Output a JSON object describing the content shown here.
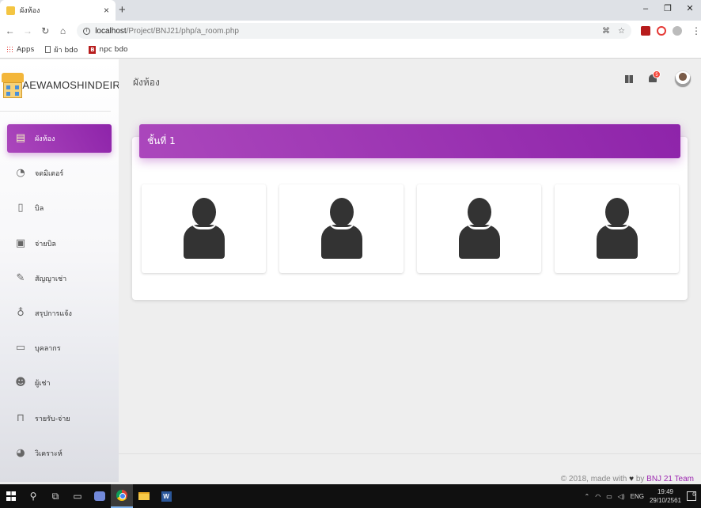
{
  "browser": {
    "tab_title": "ผังห้อง",
    "url_host": "localhost",
    "url_path": "/Project/BNJ21/php/a_room.php",
    "bookmarks": [
      "Apps",
      "ผ้า bdo",
      "npc bdo"
    ]
  },
  "sidebar": {
    "brand": "OMAEWAMOSHINDEIRU",
    "items": [
      {
        "label": "ผังห้อง",
        "icon": "building-icon",
        "active": true
      },
      {
        "label": "จดมิเตอร์",
        "icon": "dashboard-gauge-icon",
        "active": false
      },
      {
        "label": "บิล",
        "icon": "document-icon",
        "active": false
      },
      {
        "label": "จ่ายบิล",
        "icon": "money-icon",
        "active": false
      },
      {
        "label": "สัญญาเช่า",
        "icon": "edit-icon",
        "active": false
      },
      {
        "label": "สรุปการแจ้ง",
        "icon": "lightbulb-icon",
        "active": false
      },
      {
        "label": "บุคลากร",
        "icon": "id-card-icon",
        "active": false
      },
      {
        "label": "ผู้เช่า",
        "icon": "users-icon",
        "active": false
      },
      {
        "label": "รายรับ-จ่าย",
        "icon": "shopping-bag-icon",
        "active": false
      },
      {
        "label": "วิเคราะห์",
        "icon": "pie-chart-icon",
        "active": false
      }
    ]
  },
  "topnav": {
    "title": "ผังห้อง",
    "notification_count": "5"
  },
  "content": {
    "floor_title": "ชั้นที่ 1",
    "rooms": [
      "room-1",
      "room-2",
      "room-3",
      "room-4"
    ]
  },
  "footer": {
    "prefix": "© 2018, made with",
    "by": "by",
    "team": "BNJ 21 Team"
  },
  "taskbar": {
    "language": "ENG",
    "time": "19:49",
    "date": "29/10/2561",
    "notification_count": "6"
  },
  "colors": {
    "accent": "#9c27b0",
    "badge": "#f44336"
  }
}
